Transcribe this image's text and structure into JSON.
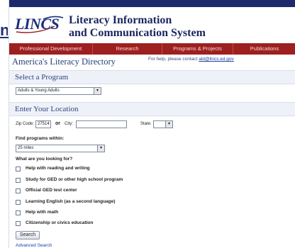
{
  "side_fragment": "n",
  "header": {
    "logo": "LINCS",
    "title_line1": "Literacy Information",
    "title_line2": "and Communication System"
  },
  "nav": [
    "Professional Development",
    "Research",
    "Programs & Projects",
    "Publications"
  ],
  "page": {
    "title": "America's Literacy Directory",
    "help_prefix": "For help, please contact ",
    "help_email": "ald@lincs.ed.gov"
  },
  "program_section": {
    "heading": "Select a Program",
    "selected": "Adults & Young Adults"
  },
  "location_section": {
    "heading": "Enter Your Location",
    "zip_label": "Zip Code:",
    "zip_value": "27514",
    "or_label": "or",
    "city_label": "City:",
    "city_value": "",
    "state_label": "State:",
    "state_value": ""
  },
  "within": {
    "label": "Find programs within:",
    "selected": "25 miles"
  },
  "looking_for": {
    "label": "What are you looking for?",
    "options": [
      "Help with reading and writing",
      "Study for GED or other high school program",
      "Official GED test center",
      "Learning English (as a second language)",
      "Help with math",
      "Citizenship or civics education"
    ]
  },
  "actions": {
    "search_label": "Search",
    "advanced_label": "Advanced Search"
  },
  "colors": {
    "topbar": "#1c2a6b",
    "nav": "#9e1f1f",
    "section_bar": "#eef1f7",
    "heading": "#263f7a"
  }
}
